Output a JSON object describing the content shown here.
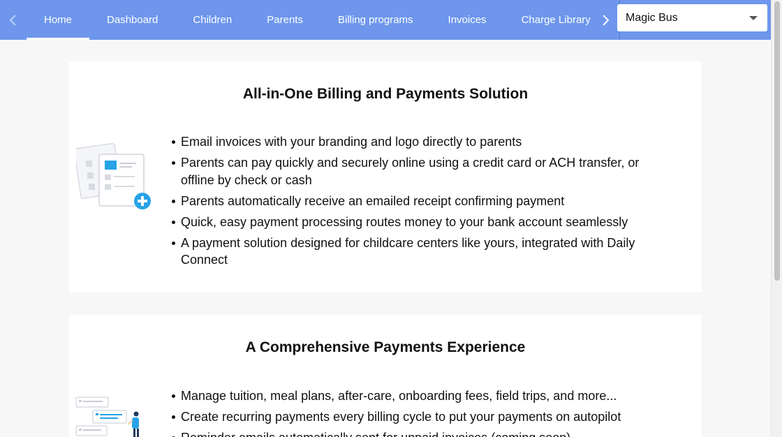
{
  "nav": {
    "tabs": [
      {
        "label": "Home"
      },
      {
        "label": "Dashboard"
      },
      {
        "label": "Children"
      },
      {
        "label": "Parents"
      },
      {
        "label": "Billing programs"
      },
      {
        "label": "Invoices"
      },
      {
        "label": "Charge Library"
      }
    ],
    "active_tab": "Home",
    "left_arrow_icon": "chevron-left-icon",
    "right_arrow_icon": "chevron-right-icon",
    "school_select": {
      "value": "Magic Bus"
    },
    "colors": {
      "bar": "#6d96ec",
      "text": "#ffffff"
    }
  },
  "cards": [
    {
      "title": "All-in-One Billing and Payments Solution",
      "illustration": "invoice-add-icon",
      "bullets": [
        "Email invoices with your branding and logo directly to parents",
        "Parents can pay quickly and securely online using a credit card or ACH transfer, or offline by check or cash",
        "Parents automatically receive an emailed receipt confirming payment",
        "Quick, easy payment processing routes money to your bank account seamlessly",
        "A payment solution designed for childcare centers like yours, integrated with Daily Connect"
      ]
    },
    {
      "title": "A Comprehensive Payments Experience",
      "illustration": "person-messages-icon",
      "bullets": [
        "Manage tuition, meal plans, after-care, onboarding fees, field trips, and more...",
        "Create recurring payments every billing cycle to put your payments on autopilot",
        "Reminder emails automatically sent for unpaid invoices (coming soon)"
      ]
    }
  ]
}
